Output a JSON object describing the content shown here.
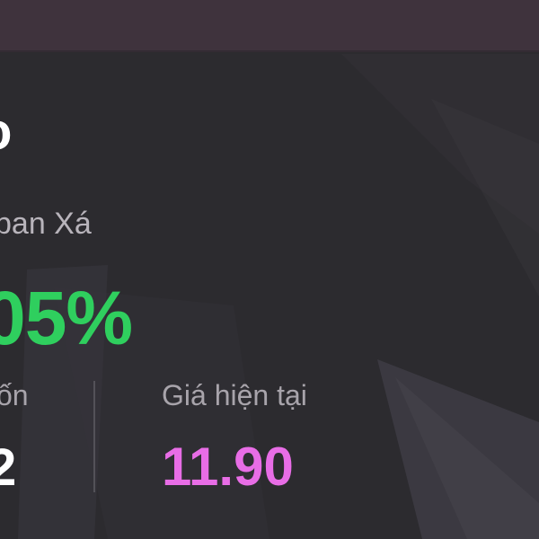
{
  "stock": {
    "symbol_partial": "o",
    "name_partial": "ban Xá",
    "change_percent": "05%",
    "reference_label": "ốn",
    "reference_value": "2",
    "current_price_label": "Giá hiện tại",
    "current_price_value": "11.90"
  },
  "colors": {
    "background": "#2c2b2f",
    "top_bar": "#3f333d",
    "change_up": "#2fcf5e",
    "current_price": "#e86de6",
    "label": "#a8a4ab",
    "primary_text": "#ffffff"
  }
}
